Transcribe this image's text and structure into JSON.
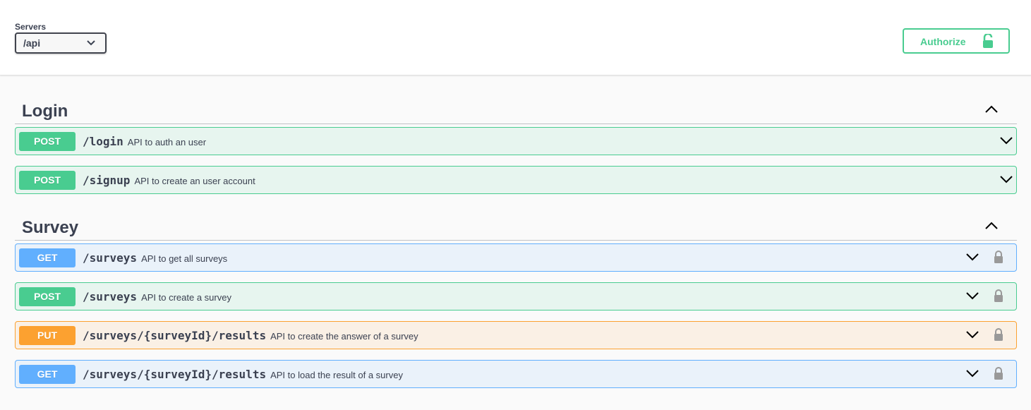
{
  "servers": {
    "label": "Servers",
    "selected": "/api"
  },
  "authorize": {
    "label": "Authorize"
  },
  "tags": [
    {
      "name": "Login",
      "operations": [
        {
          "method": "POST",
          "path": "/login",
          "description": "API to auth an user",
          "locked": false
        },
        {
          "method": "POST",
          "path": "/signup",
          "description": "API to create an user account",
          "locked": false
        }
      ]
    },
    {
      "name": "Survey",
      "operations": [
        {
          "method": "GET",
          "path": "/surveys",
          "description": "API to get all surveys",
          "locked": true
        },
        {
          "method": "POST",
          "path": "/surveys",
          "description": "API to create a survey",
          "locked": true
        },
        {
          "method": "PUT",
          "path": "/surveys/{surveyId}/results",
          "description": "API to create the answer of a survey",
          "locked": true
        },
        {
          "method": "GET",
          "path": "/surveys/{surveyId}/results",
          "description": "API to load the result of a survey",
          "locked": true
        }
      ]
    }
  ],
  "colors": {
    "post": "#49cc90",
    "get": "#61affe",
    "put": "#fca130"
  }
}
